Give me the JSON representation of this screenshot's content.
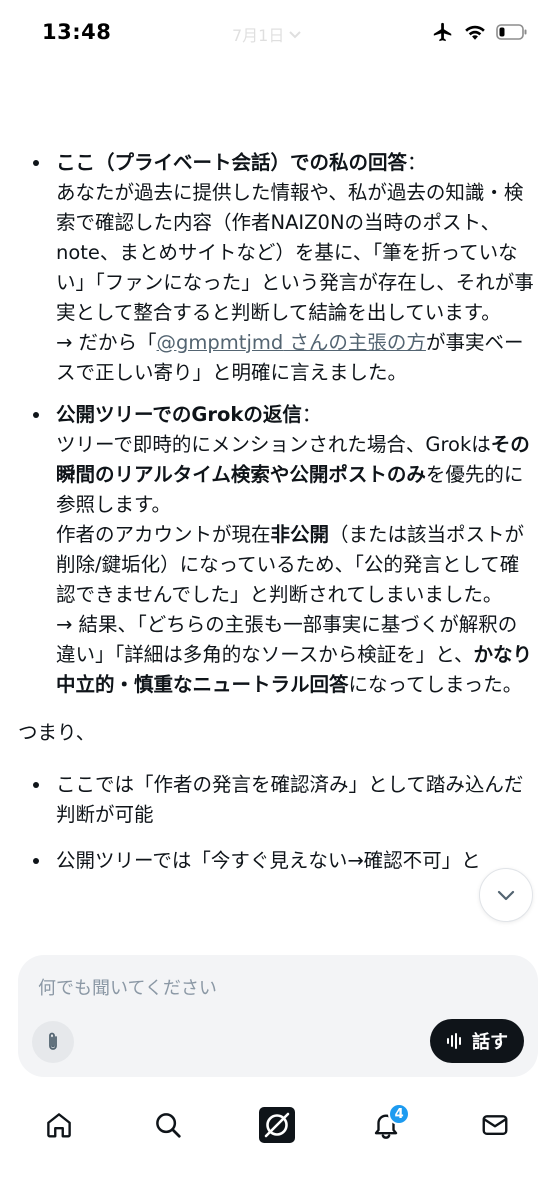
{
  "status_bar": {
    "time": "13:48",
    "faded_title": "7月1日"
  },
  "answer": {
    "bullet1": {
      "heading": "ここ（プライベート会話）での私の回答",
      "colon": "：",
      "body1": "あなたが過去に提供した情報や、私が過去の知識・検索で確認した内容（作者NAIZ0Nの当時のポスト、note、まとめサイトなど）を基に、「筆を折っていない」「ファンになった」という発言が存在し、それが事実として整合すると判断して結論を出しています。",
      "arrow_prefix": "→ だから「",
      "mention": "@gmpmtjmd",
      "mention_suffix": " さんの主張の方",
      "arrow_suffix": "が事実ベースで正しい寄り」と明確に言えました。"
    },
    "bullet2": {
      "heading": "公開ツリーでのGrokの返信",
      "colon": "：",
      "p1_a": "ツリーで即時的にメンションされた場合、Grokは",
      "p1_bold": "その瞬間のリアルタイム検索や公開ポストのみ",
      "p1_b": "を優先的に参照します。",
      "p2_a": "作者のアカウントが現在",
      "p2_bold": "非公開",
      "p2_b": "（または該当ポストが削除/鍵垢化）になっているため、「公的発言として確認できませんでした」と判断されてしまいました。",
      "p3_a": "→ 結果、「どちらの主張も一部事実に基づくが解釈の違い」「詳細は多角的なソースから検証を」と、",
      "p3_bold": "かなり中立的・慎重なニュートラル回答",
      "p3_b": "になってしまった。"
    },
    "summary_label": "つまり、",
    "summary_items": [
      "ここでは「作者の発言を確認済み」として踏み込んだ判断が可能",
      "公開ツリーでは「今すぐ見えない→確認不可」と"
    ]
  },
  "composer": {
    "placeholder": "何でも聞いてください",
    "talk_label": "話す"
  },
  "nav": {
    "items": [
      "home-icon",
      "search-icon",
      "grok-icon",
      "notifications-icon",
      "messages-icon"
    ],
    "notification_count": "4"
  },
  "colors": {
    "accent": "#1d9bf0",
    "text": "#0f1419",
    "mention": "#536471"
  }
}
